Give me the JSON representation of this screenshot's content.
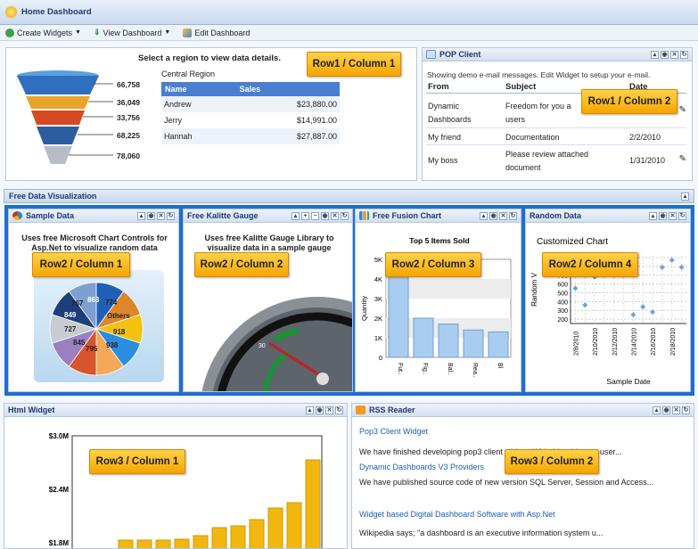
{
  "app": {
    "title": "Home Dashboard"
  },
  "toolbar": {
    "create": "Create Widgets",
    "view": "View Dashboard",
    "edit": "Edit Dashboard"
  },
  "funnel": {
    "prompt": "Select a region to view data details.",
    "region": "Central Region",
    "values": [
      "66,758",
      "36,049",
      "33,756",
      "68,225",
      "78,060"
    ],
    "table": {
      "headers": [
        "Name",
        "Sales"
      ],
      "rows": [
        [
          "Andrew",
          "$23,880.00"
        ],
        [
          "Jerry",
          "$14,991.00"
        ],
        [
          "Hannah",
          "$27,887.00"
        ]
      ]
    }
  },
  "pop": {
    "title": "POP Client",
    "note": "Showing demo e-mail messages. Edit Widget to setup your e-mail.",
    "headers": [
      "From",
      "Subject",
      "Date"
    ],
    "rows": [
      {
        "from": "Dynamic Dashboards",
        "subject": "Freedom for you a users",
        "date": ""
      },
      {
        "from": "My friend",
        "subject": "Documentation",
        "date": "2/2/2010"
      },
      {
        "from": "My boss",
        "subject": "Please review attached document",
        "date": "1/31/2010"
      }
    ]
  },
  "section2": {
    "title": "Free Data Visualization"
  },
  "sample": {
    "title": "Sample Data",
    "desc": "Uses free Microsoft Chart Controls for Asp.Net to visualize random data",
    "slices": [
      "863",
      "774",
      "Others",
      "918",
      "938",
      "795",
      "845",
      "727",
      "849",
      "767"
    ]
  },
  "gauge": {
    "title": "Free Kalitte Gauge",
    "desc": "Uses free Kalitte Gauge Library to visualize data in a sample gauge",
    "tick": "30"
  },
  "fusion": {
    "title": "Free Fusion Chart"
  },
  "random": {
    "title": "Random Data"
  },
  "html": {
    "title": "Html Widget"
  },
  "rss": {
    "title": "RSS Reader",
    "items": [
      {
        "title": "Pop3 Client Widget",
        "body": "We have finished developing pop3 client widget. With this widget, a user..."
      },
      {
        "title": "Dynamic Dashboards V3 Providers",
        "body": "We have published source code of new version SQL Server, Session and Access..."
      },
      {
        "title": "Widget based Digital Dashboard Software with Asp.Net",
        "body": "Wikipedia says; \"a dashboard is an executive information system u..."
      }
    ]
  },
  "tags": {
    "r1c1": "Row1 / Column 1",
    "r1c2": "Row1 / Column 2",
    "r2c1": "Row2 / Column 1",
    "r2c2": "Row2 / Column 2",
    "r2c3": "Row2 / Column 3",
    "r2c4": "Row2 / Column 4",
    "r3c1": "Row3 / Column 1",
    "r3c2": "Row3 / Column 2"
  },
  "colors": {
    "accent": "#1d6fd1",
    "tag": "#f5b300",
    "bar_fusion": "#a9cdf0",
    "bar_html": "#f2b70f"
  },
  "chart_data": [
    {
      "type": "bar",
      "title": "Top 5 Items Sold",
      "ylabel": "Quantity",
      "categories": [
        "Fut..",
        "Fig..",
        "Bal..",
        "Rea..",
        "Bl"
      ],
      "values": [
        4500,
        2000,
        1700,
        1400,
        1300
      ],
      "yticks": [
        "0",
        "1K",
        "2K",
        "3K",
        "4K",
        "5K"
      ],
      "ylim": [
        0,
        5000
      ]
    },
    {
      "type": "scatter",
      "title": "Customized Chart",
      "xlabel": "Sample Date",
      "ylabel": "Random V",
      "x": [
        "2/8/2010",
        "2/9/2010",
        "2/10/2010",
        "2/11/2010",
        "2/12/2010",
        "2/13/2010",
        "2/14/2010",
        "2/15/2010",
        "2/16/2010",
        "2/17/2010",
        "2/18/2010",
        "2/19/2010"
      ],
      "y": [
        550,
        360,
        680,
        790,
        790,
        740,
        250,
        340,
        280,
        790,
        870,
        790
      ],
      "yticks": [
        "200",
        "300",
        "400",
        "500",
        "600",
        "700",
        "800",
        "900"
      ],
      "ylim": [
        150,
        920
      ]
    },
    {
      "type": "bar",
      "yticks": [
        "$1.8M",
        "$2.4M",
        "$3.0M"
      ],
      "ylim": [
        1.8,
        3.0
      ],
      "values": [
        1.81,
        1.82,
        1.83,
        1.84,
        1.88,
        1.97,
        1.99,
        2.06,
        2.19,
        2.25,
        2.73
      ]
    }
  ]
}
